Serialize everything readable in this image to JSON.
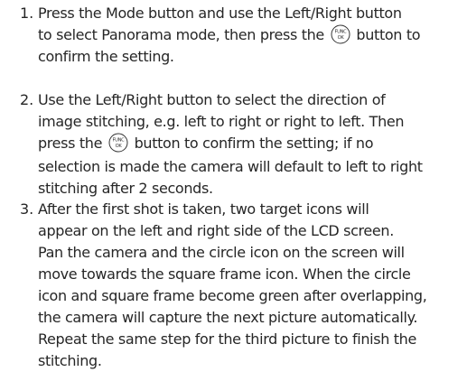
{
  "icon": {
    "name": "func-ok-button-icon",
    "text_top": "FUNC",
    "text_bottom": "OK"
  },
  "steps": [
    {
      "number": "1.",
      "lines": [
        "Press the Mode button and use the Left/Right button",
        "to select Panorama mode, then press the",
        "button to",
        "confirm the setting."
      ]
    },
    {
      "number": "2.",
      "lines": [
        "Use the Left/Right button to select the direction of",
        "image stitching, e.g. left to right or right to left. Then",
        "press the",
        "button to confirm the setting; if no",
        "selection is made the camera will default to left to right",
        "stitching after 2 seconds."
      ]
    },
    {
      "number": "3.",
      "lines": [
        "After the first shot is taken, two target icons will",
        "appear on the left and right side of the LCD screen.",
        "Pan the camera and the circle icon on the screen will",
        "move towards the square frame icon. When the circle",
        "icon and square frame become green after overlapping,",
        "the camera will capture the next picture automatically.",
        "Repeat the same step for the third picture to finish the",
        "stitching."
      ]
    }
  ]
}
